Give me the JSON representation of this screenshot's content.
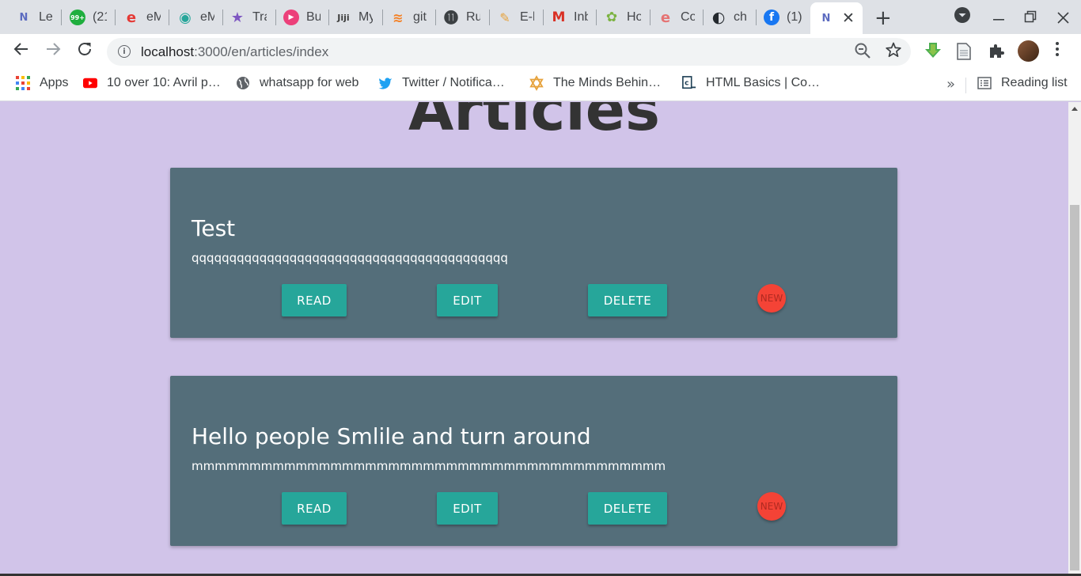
{
  "browser": {
    "tabs": [
      {
        "title": "Le",
        "favicon": "N",
        "color": "#5c6bc0"
      },
      {
        "title": "(21",
        "favicon": "99+",
        "color": "#1fae3e"
      },
      {
        "title": "eM",
        "favicon": "e",
        "color": "#e53935"
      },
      {
        "title": "eM",
        "favicon": "◉",
        "color": "#26a69a"
      },
      {
        "title": "Tra",
        "favicon": "★",
        "color": "#7e57c2"
      },
      {
        "title": "Bu",
        "favicon": "▶",
        "color": "#ec407a"
      },
      {
        "title": "My",
        "favicon": "Jiji",
        "color": "#3d3d3d"
      },
      {
        "title": "git",
        "favicon": "≋",
        "color": "#f48024"
      },
      {
        "title": "Ru",
        "favicon": "⓫",
        "color": "#3c4043"
      },
      {
        "title": "E-l",
        "favicon": "✎",
        "color": "#e6a23c"
      },
      {
        "title": "Inb",
        "favicon": "M",
        "color": "#d93025"
      },
      {
        "title": "Ho",
        "favicon": "✿",
        "color": "#7cb342"
      },
      {
        "title": "Co",
        "favicon": "e",
        "color": "#e57373"
      },
      {
        "title": "ch",
        "favicon": "◐",
        "color": "#24292e"
      },
      {
        "title": "(1)",
        "favicon": "f",
        "color": "#1877f2"
      }
    ],
    "active_tab": {
      "favicon": "N",
      "color": "#5c6bc0",
      "close": "✕"
    },
    "new_tab_label": "+",
    "address": {
      "host": "localhost",
      "path": ":3000/en/articles/index"
    },
    "bookmarks": [
      {
        "label": "Apps",
        "icon": "apps-grid"
      },
      {
        "label": "10 over 10: Avril p…",
        "icon": "youtube-icon"
      },
      {
        "label": "whatsapp for web",
        "icon": "globe-icon"
      },
      {
        "label": "Twitter / Notifica…",
        "icon": "twitter-icon"
      },
      {
        "label": "The Minds Behin…",
        "icon": "star-of-david-icon"
      },
      {
        "label": "HTML Basics | Co…",
        "icon": "codecademy-icon"
      }
    ],
    "bookmarks_overflow": "»",
    "reading_list": "Reading list"
  },
  "page": {
    "title": "Articles",
    "articles": [
      {
        "title": "Test",
        "body": "qqqqqqqqqqqqqqqqqqqqqqqqqqqqqqqqqqqqqqqqqq",
        "read": "READ",
        "edit": "EDIT",
        "delete": "DELETE",
        "badge": "NEW"
      },
      {
        "title": "Hello people Smlile and turn around",
        "body": "mmmmmmmmmmmmmmmmmmmmmmmmmmmmmmmmmmmmmmmmm",
        "read": "READ",
        "edit": "EDIT",
        "delete": "DELETE",
        "badge": "NEW"
      }
    ]
  }
}
